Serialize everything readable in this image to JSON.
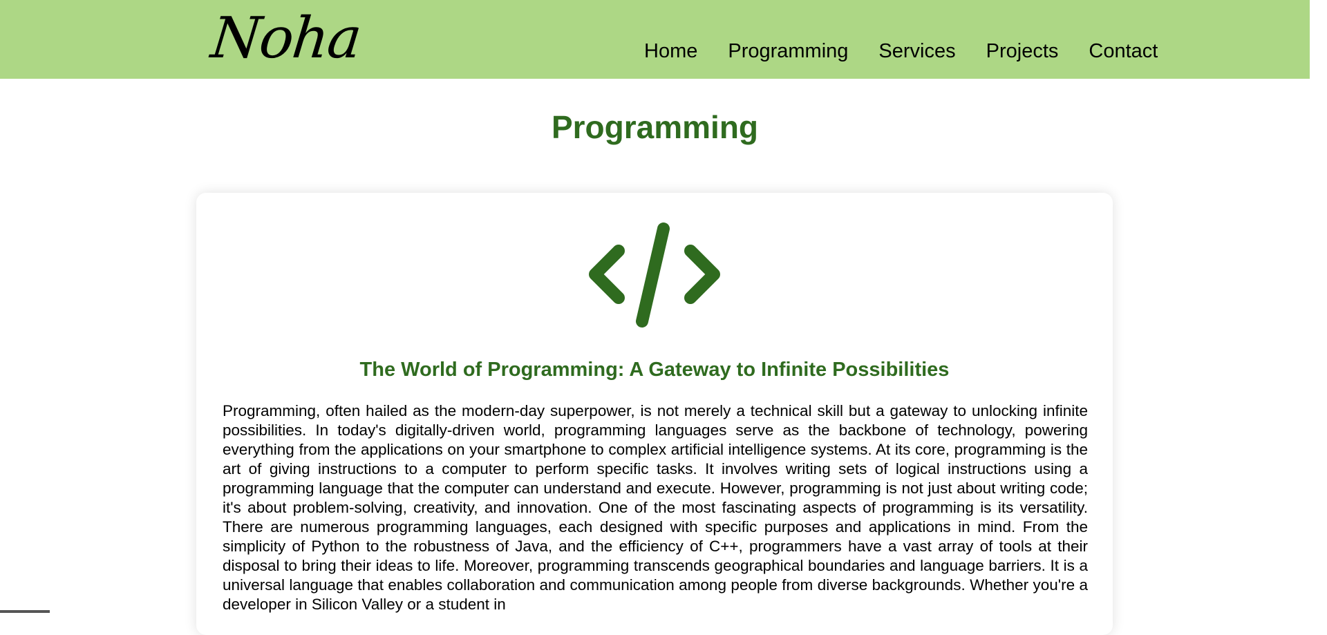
{
  "header": {
    "logo": "Noha",
    "nav": [
      "Home",
      "Programming",
      "Services",
      "Projects",
      "Contact"
    ]
  },
  "main": {
    "page_title": "Programming",
    "card": {
      "icon": "code-icon",
      "title": "The World of Programming: A Gateway to Infinite Possibilities",
      "body": "Programming, often hailed as the modern-day superpower, is not merely a technical skill but a gateway to unlocking infinite possibilities. In today's digitally-driven world, programming languages serve as the backbone of technology, powering everything from the applications on your smartphone to complex artificial intelligence systems. At its core, programming is the art of giving instructions to a computer to perform specific tasks. It involves writing sets of logical instructions using a programming language that the computer can understand and execute. However, programming is not just about writing code; it's about problem-solving, creativity, and innovation. One of the most fascinating aspects of programming is its versatility. There are numerous programming languages, each designed with specific purposes and applications in mind. From the simplicity of Python to the robustness of Java, and the efficiency of C++, programmers have a vast array of tools at their disposal to bring their ideas to life. Moreover, programming transcends geographical boundaries and language barriers. It is a universal language that enables collaboration and communication among people from diverse backgrounds. Whether you're a developer in Silicon Valley or a student in"
    }
  },
  "colors": {
    "header_bg": "#add785",
    "accent_green": "#2f6b1f",
    "text": "#000000"
  }
}
